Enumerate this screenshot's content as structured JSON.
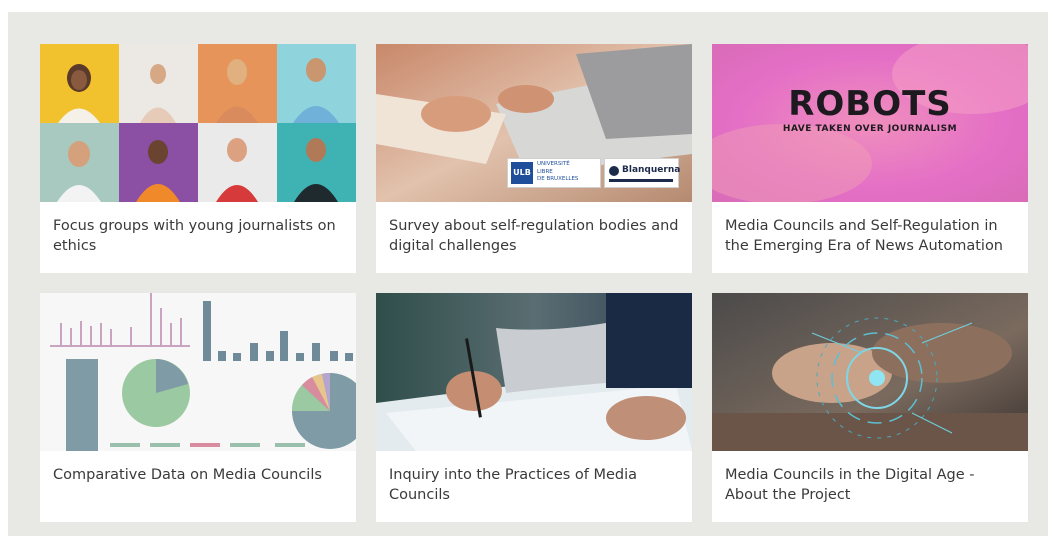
{
  "cards": [
    {
      "title": "Focus groups with young journalists on ethics",
      "image": "portrait-grid-photo"
    },
    {
      "title": "Survey about self-regulation bodies and digital challenges",
      "image": "laptop-desk-photo",
      "logos": {
        "ulb_mark": "ULB",
        "ulb_text": [
          "UNIVERSITÉ",
          "LIBRE",
          "DE BRUXELLES"
        ],
        "blanquerna": "Blanquerna"
      }
    },
    {
      "title": "Media Councils and Self-Regulation in the Emerging Era of News Automation",
      "image": "robots-poster",
      "poster": {
        "headline": "ROBOTS",
        "subline": "HAVE TAKEN OVER JOURNALISM"
      }
    },
    {
      "title": "Comparative Data on Media Councils",
      "image": "charts-collage"
    },
    {
      "title": "Inquiry into the Practices of Media Councils",
      "image": "hand-writing-photo"
    },
    {
      "title": "Media Councils in the Digital Age - About the Project",
      "image": "digital-hand-photo"
    }
  ],
  "colors": {
    "frame_bg": "#e8e8e5",
    "card_bg": "#ffffff",
    "title_text": "#3a3a3a",
    "poster_pink": "#e46fc6"
  }
}
